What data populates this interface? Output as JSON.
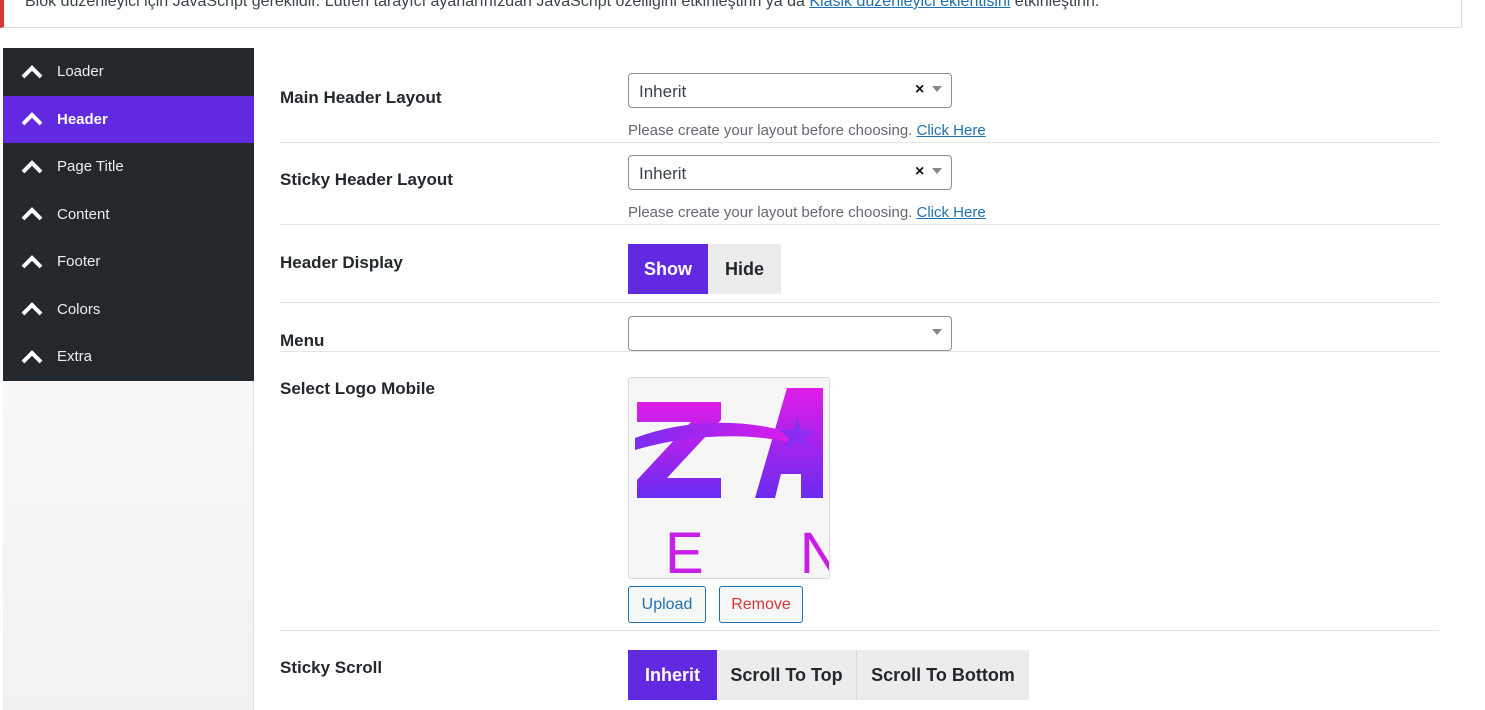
{
  "notice": {
    "text_before": "Blok düzenleyici için JavaScript gereklidir. Lütfen tarayıcı ayarlarınızdan JavaScript özelliğini etkinleştirin ya da ",
    "link": "Klasik düzenleyici eklentisini",
    "text_after": " etkinleştirin."
  },
  "sidebar": {
    "items": [
      {
        "label": "Loader"
      },
      {
        "label": "Header"
      },
      {
        "label": "Page Title"
      },
      {
        "label": "Content"
      },
      {
        "label": "Footer"
      },
      {
        "label": "Colors"
      },
      {
        "label": "Extra"
      }
    ],
    "active": "Header"
  },
  "main_header": {
    "label": "Main Header Layout",
    "value": "Inherit",
    "clear": "×",
    "help_text": "Please create your layout before choosing. ",
    "help_link": "Click Here"
  },
  "sticky_header": {
    "label": "Sticky Header Layout",
    "value": "Inherit",
    "clear": "×",
    "help_text": "Please create your layout before choosing. ",
    "help_link": "Click Here"
  },
  "header_display": {
    "label": "Header Display",
    "options": [
      "Show",
      "Hide"
    ],
    "selected": "Show"
  },
  "menu": {
    "label": "Menu",
    "value": ""
  },
  "logo_mobile": {
    "label": "Select Logo Mobile",
    "logo_letters_top": "ZA",
    "logo_letters_bottom": "E N",
    "upload": "Upload",
    "remove": "Remove"
  },
  "sticky_scroll": {
    "label": "Sticky Scroll",
    "options": [
      "Inherit",
      "Scroll To Top",
      "Scroll To Bottom"
    ],
    "selected": "Inherit"
  },
  "colors": {
    "accent": "#6129e0",
    "sidebar_bg": "#23282d",
    "link": "#2271b1",
    "error": "#d63638",
    "remove": "#d63638",
    "logo_magenta": "#e01ce8",
    "logo_purple": "#6a2cf0"
  }
}
